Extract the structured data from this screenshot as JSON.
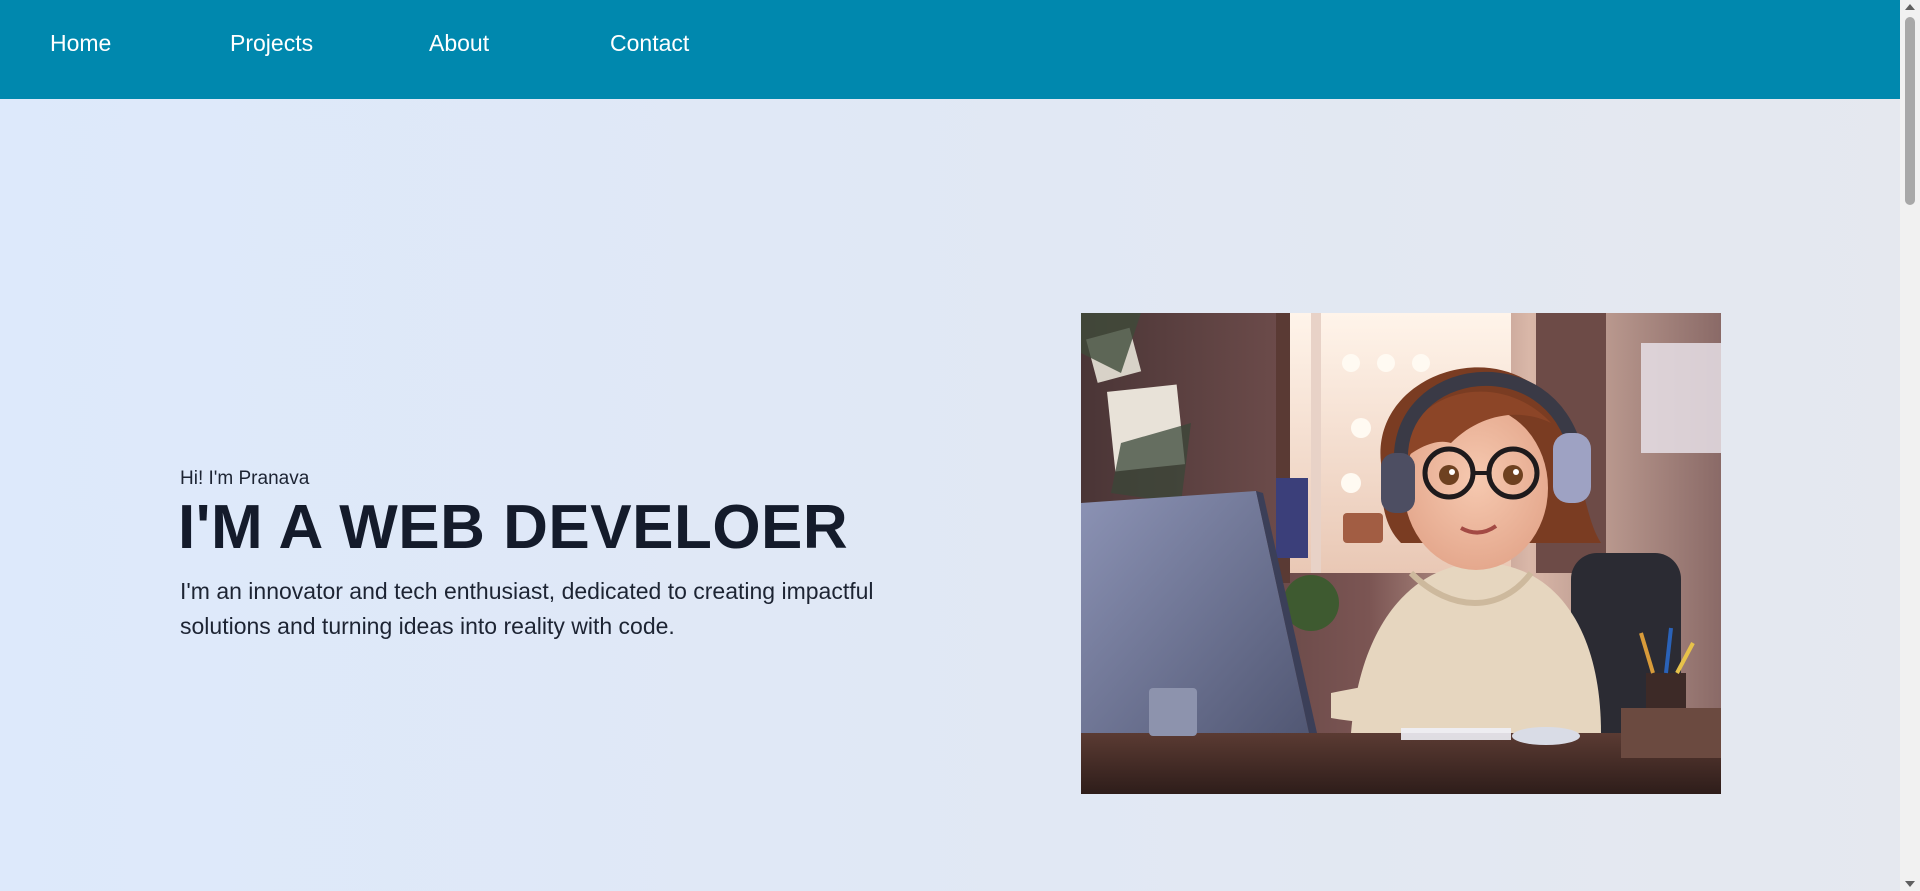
{
  "nav": {
    "items": [
      {
        "label": "Home"
      },
      {
        "label": "Projects"
      },
      {
        "label": "About"
      },
      {
        "label": "Contact"
      }
    ]
  },
  "hero": {
    "greeting": "Hi! I'm Pranava",
    "headline": "I'M A WEB DEVELOER",
    "bio": "I'm an innovator and tech enthusiast, dedicated to creating impactful solutions and turning ideas into reality with code.",
    "image_icon": "developer-illustration"
  },
  "colors": {
    "navbar": "#0088ae",
    "headline": "#141b2b",
    "background": "#dde9fb"
  }
}
